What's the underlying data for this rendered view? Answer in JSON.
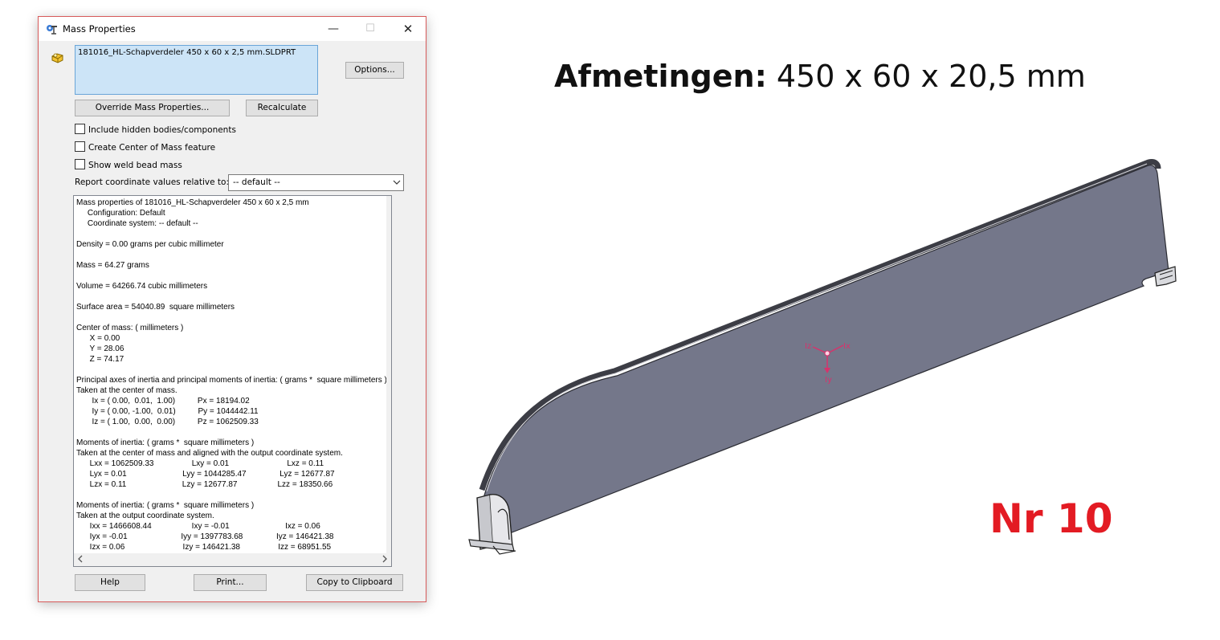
{
  "window": {
    "title": "Mass Properties",
    "minimize_glyph": "—",
    "maximize_glyph": "☐",
    "close_glyph": "✕"
  },
  "selection": {
    "file": "181016_HL-Schapverdeler 450 x 60 x 2,5 mm.SLDPRT"
  },
  "buttons": {
    "options": "Options...",
    "override": "Override Mass Properties...",
    "recalculate": "Recalculate",
    "help": "Help",
    "print": "Print...",
    "copy": "Copy to Clipboard"
  },
  "checkboxes": [
    {
      "label": "Include hidden bodies/components",
      "checked": false
    },
    {
      "label": "Create Center of Mass feature",
      "checked": false
    },
    {
      "label": "Show weld bead mass",
      "checked": false
    }
  ],
  "report_relative": {
    "label": "Report coordinate values relative to:",
    "value": "-- default --"
  },
  "report_text": "Mass properties of 181016_HL-Schapverdeler 450 x 60 x 2,5 mm\n     Configuration: Default\n     Coordinate system: -- default --\n\nDensity = 0.00 grams per cubic millimeter\n\nMass = 64.27 grams\n\nVolume = 64266.74 cubic millimeters\n\nSurface area = 54040.89  square millimeters\n\nCenter of mass: ( millimeters )\n      X = 0.00\n      Y = 28.06\n      Z = 74.17\n\nPrincipal axes of inertia and principal moments of inertia: ( grams *  square millimeters )\nTaken at the center of mass.\n       Ix = ( 0.00,  0.01,  1.00)          Px = 18194.02\n       Iy = ( 0.00, -1.00,  0.01)          Py = 1044442.11\n       Iz = ( 1.00,  0.00,  0.00)          Pz = 1062509.33\n\nMoments of inertia: ( grams *  square millimeters )\nTaken at the center of mass and aligned with the output coordinate system.\n      Lxx = 1062509.33                 Lxy = 0.01                          Lxz = 0.11\n      Lyx = 0.01                         Lyy = 1044285.47               Lyz = 12677.87\n      Lzx = 0.11                         Lzy = 12677.87                  Lzz = 18350.66\n\nMoments of inertia: ( grams *  square millimeters )\nTaken at the output coordinate system.\n      Ixx = 1466608.44                  Ixy = -0.01                         Ixz = 0.06\n      Iyx = -0.01                        Iyy = 1397783.68               Iyz = 146421.38\n      Izx = 0.06                          Izy = 146421.38                 Izz = 68951.55",
  "headline": {
    "bold": "Afmetingen:",
    "rest": " 450 x 60 x 20,5 mm"
  },
  "tag": "Nr 10",
  "triad": {
    "x": "Ix",
    "y": "Iy",
    "z": "Iz"
  },
  "colors": {
    "selection_bg": "#cce4f7",
    "window_border": "#d75a5a",
    "tag_red": "#e31b23",
    "part_fill": "#74778a",
    "triad": "#d6336c"
  },
  "icons": {
    "title": "mass-properties-icon",
    "part": "part-icon",
    "dropdown": "chevron-down-icon",
    "scroll_left": "arrow-left-icon",
    "scroll_right": "arrow-right-icon"
  }
}
